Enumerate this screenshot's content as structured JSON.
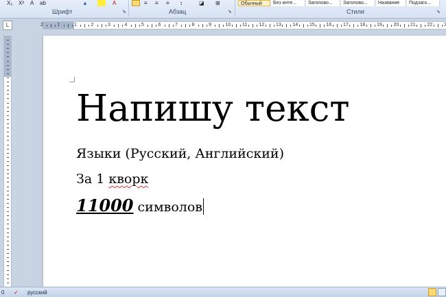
{
  "ribbon": {
    "groups": {
      "font": "Шрифт",
      "paragraph": "Абзац",
      "styles": "Стили"
    },
    "styles": [
      "Обычный",
      "Без инте...",
      "Заголово...",
      "Заголово...",
      "Название",
      "Подзаго..."
    ],
    "font_icons": [
      "X₂",
      "X²",
      "A",
      "ab",
      "A"
    ],
    "icons": [
      "bold-toolbar-icon",
      "highlight-icon",
      "font-color-icon",
      "align-left-icon",
      "align-center-icon",
      "align-right-icon",
      "justify-icon",
      "line-spacing-icon",
      "shading-icon",
      "borders-icon"
    ]
  },
  "ruler": {
    "corner": "L",
    "numbers": [
      "2",
      "1",
      "1",
      "2",
      "3",
      "4",
      "5",
      "6",
      "7",
      "8",
      "9",
      "10",
      "11",
      "12",
      "13",
      "14",
      "15",
      "16",
      "17",
      "18",
      "19",
      "20",
      "21",
      "22",
      "23"
    ]
  },
  "document": {
    "title": "Напишу текст",
    "line1": "Языки (Русский, Английский)",
    "line2_prefix": "За 1 ",
    "line2_word": "кворк",
    "line3_number": "11000",
    "line3_rest": " символов"
  },
  "statusbar": {
    "words": "0",
    "language": "русский"
  },
  "colors": {
    "accent": "#e8b64b",
    "ribbon": "#dfe8f5",
    "background": "#c9d4e3",
    "spellcheck": "#d83030"
  }
}
